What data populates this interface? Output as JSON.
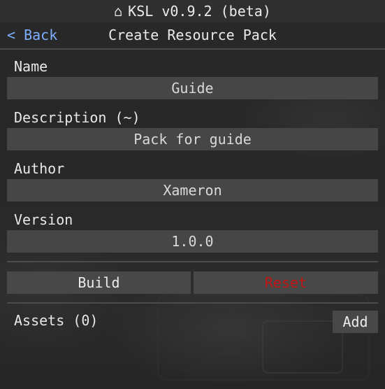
{
  "titlebar": {
    "home_icon": "⌂",
    "title": "KSL v0.9.2 (beta)"
  },
  "header": {
    "back_label": "< Back",
    "title": "Create Resource Pack"
  },
  "form": {
    "name_label": "Name",
    "name_value": "Guide",
    "description_label": "Description (~)",
    "description_value": "Pack for guide",
    "author_label": "Author",
    "author_value": "Xameron",
    "version_label": "Version",
    "version_value": "1.0.0"
  },
  "actions": {
    "build_label": "Build",
    "reset_label": "Reset"
  },
  "assets": {
    "label": "Assets (0)",
    "add_label": "Add"
  },
  "colors": {
    "link": "#7fb0ff",
    "danger": "#c31414",
    "field_bg": "#464646"
  }
}
